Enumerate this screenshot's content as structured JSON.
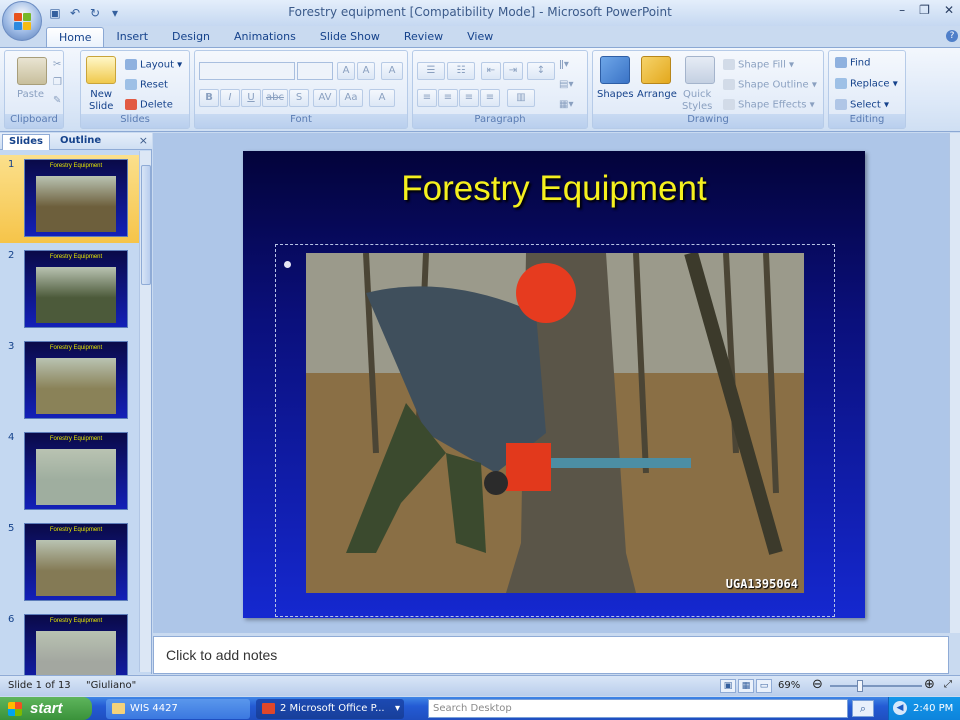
{
  "app": {
    "title": "Forestry equipment [Compatibility Mode] - Microsoft PowerPoint",
    "window_buttons": [
      "–",
      "❐",
      "✕"
    ]
  },
  "ribbon_tabs": [
    {
      "label": "Home",
      "active": true
    },
    {
      "label": "Insert"
    },
    {
      "label": "Design"
    },
    {
      "label": "Animations"
    },
    {
      "label": "Slide Show"
    },
    {
      "label": "Review"
    },
    {
      "label": "View"
    }
  ],
  "ribbon": {
    "clipboard": {
      "group_label": "Clipboard",
      "paste": "Paste"
    },
    "slides": {
      "group_label": "Slides",
      "new_slide": "New\nSlide",
      "new_slide_line1": "New",
      "new_slide_line2": "Slide",
      "layout": "Layout",
      "reset": "Reset",
      "delete": "Delete"
    },
    "font": {
      "group_label": "Font",
      "bold": "B",
      "italic": "I",
      "underline": "U",
      "strike": "abc",
      "shadow": "S",
      "spacing": "AV",
      "case": "Aa",
      "grow": "A",
      "shrink": "A",
      "clear": "A"
    },
    "paragraph": {
      "group_label": "Paragraph"
    },
    "drawing": {
      "group_label": "Drawing",
      "shapes": "Shapes",
      "arrange": "Arrange",
      "quick_styles_line1": "Quick",
      "quick_styles_line2": "Styles",
      "shape_fill": "Shape Fill",
      "shape_outline": "Shape Outline",
      "shape_effects": "Shape Effects"
    },
    "editing": {
      "group_label": "Editing",
      "find": "Find",
      "replace": "Replace",
      "select": "Select"
    }
  },
  "pane": {
    "tabs": [
      "Slides",
      "Outline"
    ],
    "close": "×",
    "thumbnails": [
      {
        "num": "1",
        "title": "Forestry Equipment",
        "selected": true
      },
      {
        "num": "2",
        "title": "Forestry Equipment"
      },
      {
        "num": "3",
        "title": "Forestry Equipment"
      },
      {
        "num": "4",
        "title": "Forestry Equipment"
      },
      {
        "num": "5",
        "title": "Forestry Equipment"
      },
      {
        "num": "6",
        "title": "Forestry Equipment"
      }
    ]
  },
  "slide": {
    "title": "Forestry Equipment",
    "photo_caption": "UGA1395064"
  },
  "notes": {
    "placeholder": "Click to add notes"
  },
  "status": {
    "slide_info": "Slide 1 of 13",
    "theme": "\"Giuliano\"",
    "zoom": "69%",
    "zoom_level": 0.69
  },
  "taskbar": {
    "start": "start",
    "tasks": [
      {
        "label": "WIS 4427"
      },
      {
        "label": "2 Microsoft Office P..."
      }
    ],
    "search_placeholder": "Search Desktop",
    "clock": "2:40 PM"
  },
  "colors": {
    "slide_title": "#f5f01e",
    "slide_bg_top": "#03033a",
    "slide_bg_bottom": "#1528d0",
    "selected_thumb": "#f6c449"
  }
}
